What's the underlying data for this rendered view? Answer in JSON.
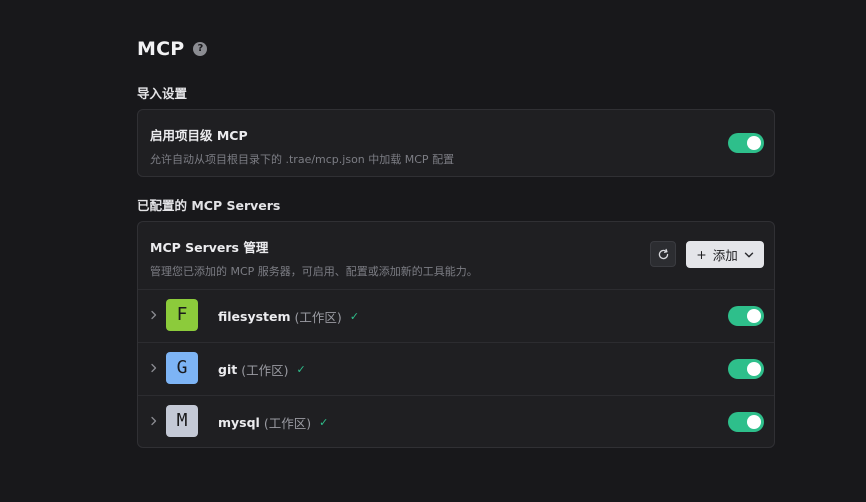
{
  "header": {
    "title": "MCP",
    "help_icon": "?"
  },
  "import_settings": {
    "section_title": "导入设置",
    "project_mcp": {
      "title": "启用项目级 MCP",
      "description": "允许自动从项目根目录下的 .trae/mcp.json 中加载 MCP 配置",
      "enabled": true
    }
  },
  "configured": {
    "section_title": "已配置的 MCP Servers",
    "manager": {
      "title": "MCP Servers 管理",
      "description": "管理您已添加的 MCP 服务器，可启用、配置或添加新的工具能力。",
      "refresh_icon": "refresh-icon",
      "add_label": "添加",
      "add_icon": "+"
    },
    "servers": [
      {
        "initial": "F",
        "name": "filesystem",
        "scope": "(工作区)",
        "status": "✓",
        "enabled": true,
        "color": "#8ccb3b"
      },
      {
        "initial": "G",
        "name": "git",
        "scope": "(工作区)",
        "status": "✓",
        "enabled": true,
        "color": "#7db4f5"
      },
      {
        "initial": "M",
        "name": "mysql",
        "scope": "(工作区)",
        "status": "✓",
        "enabled": true,
        "color": "#c4c9d6"
      }
    ]
  },
  "colors": {
    "background": "#18181b",
    "card": "#1f1f22",
    "accent": "#2ebf8b"
  }
}
